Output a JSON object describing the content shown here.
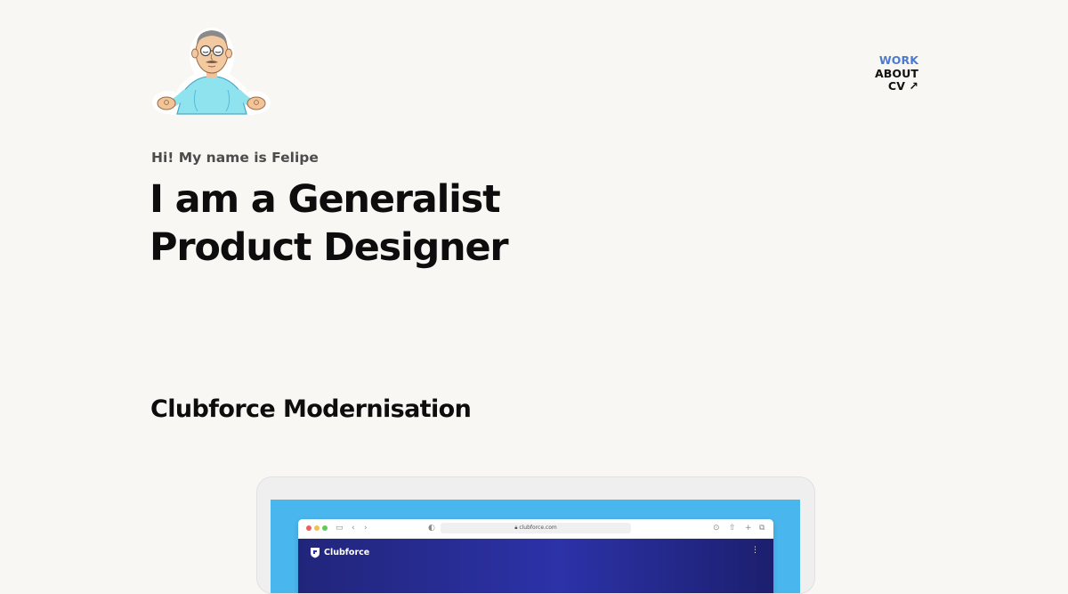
{
  "profile": {
    "avatar_icon": "meditating-avatar-icon"
  },
  "nav": {
    "items": [
      {
        "label": "WORK",
        "active": true
      },
      {
        "label": "ABOUT",
        "active": false
      },
      {
        "label": "CV ↗",
        "active": false
      }
    ]
  },
  "hero": {
    "greeting": "Hi! My name is Felipe",
    "headline_line1": "I am a Generalist",
    "headline_line2": "Product Designer"
  },
  "project": {
    "title": "Clubforce Modernisation",
    "preview": {
      "url": "clubforce.com",
      "site_name": "Clubforce",
      "menu_icon": "⋮"
    }
  },
  "colors": {
    "background": "#f9f7f4",
    "nav_active": "#4a7bd0",
    "preview_bg": "#4ab6ee",
    "site_header": "#2c32a8"
  }
}
